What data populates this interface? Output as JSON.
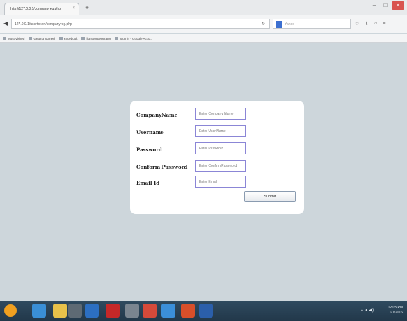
{
  "browser": {
    "tab_title": "http://127.0.0.1/companyreg.php",
    "tab_close": "×",
    "new_tab": "+",
    "back": "◀",
    "url": "127.0.0.1/usertoken/companyreg.php",
    "reload": "↻",
    "search_placeholder": "Yahoo",
    "tool_icons": [
      "☆",
      "⬇",
      "⌂",
      "≡"
    ],
    "bookmarks": [
      "Most Visited",
      "Getting Started",
      "Facebook",
      "lightboxgenerator",
      "Sign in - Google Acco..."
    ]
  },
  "form": {
    "fields": [
      {
        "label": "CompanyName",
        "placeholder": "Enter Company Name"
      },
      {
        "label": "Username",
        "placeholder": "Enter User Name"
      },
      {
        "label": "Password",
        "placeholder": "Enter Password"
      },
      {
        "label": "Conform Password",
        "placeholder": "Enter Confirm Password"
      },
      {
        "label": "Email Id",
        "placeholder": "Enter Email"
      }
    ],
    "submit_label": "Submit"
  },
  "taskbar": {
    "tray": "▲ ◐ ◀)",
    "time": "12:05 PM",
    "date": "1/1/2016",
    "colors": {
      "start": "#f0a020",
      "ie": "#3a8fd6",
      "explorer": "#e8c24a",
      "app4": "#5e6a74",
      "app5": "#2c6fc2",
      "app6": "#c62828",
      "app7": "#7a8590",
      "app8": "#d64a3a",
      "app9": "#3b8fd9",
      "app10": "#d84f2a",
      "app11": "#2b5fab"
    }
  }
}
